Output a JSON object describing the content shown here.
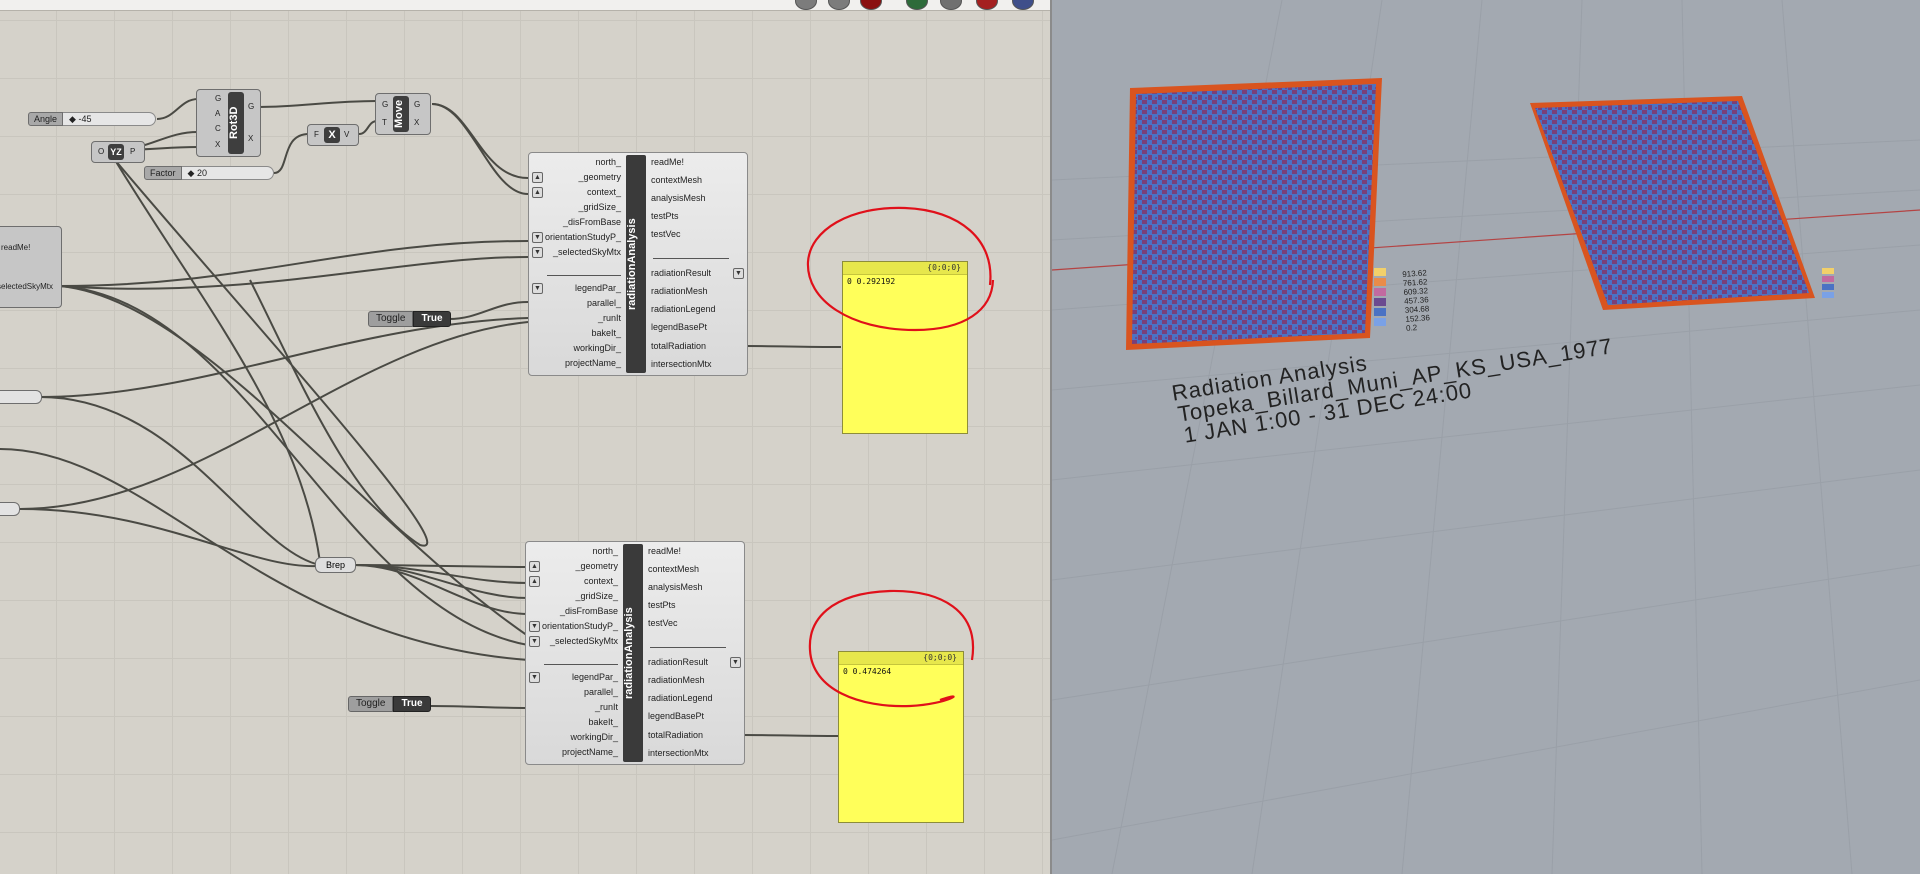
{
  "canvas": {
    "sliders": [
      {
        "label": "Angle",
        "value": "-45"
      },
      {
        "label": "Factor",
        "value": "20"
      }
    ],
    "components": {
      "rot3d": {
        "name": "Rot3D",
        "inputs": [
          "G",
          "A",
          "C",
          "X"
        ],
        "outputs": [
          "G",
          "X"
        ]
      },
      "move": {
        "name": "Move",
        "inputs": [
          "G",
          "T"
        ],
        "outputs": [
          "G",
          "X"
        ]
      },
      "yz": {
        "name": "YZ",
        "inputs": [
          "O"
        ],
        "outputs": [
          "P"
        ]
      },
      "multiply": {
        "name": "X",
        "inputs": [
          "F"
        ],
        "outputs": [
          "V"
        ]
      },
      "partial_left": {
        "outputs": [
          "readMe!",
          "selectedSkyMtx"
        ]
      },
      "brep": {
        "label": "Brep"
      }
    },
    "toggles": [
      {
        "label": "Toggle",
        "value": "True"
      },
      {
        "label": "Toggle",
        "value": "True"
      }
    ],
    "radiation_analysis": {
      "title": "radiationAnalysis",
      "inputs": [
        "north_",
        "_geometry",
        "context_",
        "_gridSize_",
        "_disFromBase",
        "orientationStudyP_",
        "_selectedSkyMtx",
        "legendPar_",
        "parallel_",
        "_runIt",
        "bakeIt_",
        "workingDir_",
        "projectName_"
      ],
      "outputs": [
        "readMe!",
        "contextMesh",
        "analysisMesh",
        "testPts",
        "testVec",
        "radiationResult",
        "radiationMesh",
        "radiationLegend",
        "legendBasePt",
        "totalRadiation",
        "intersectionMtx"
      ]
    },
    "panels": [
      {
        "path": "{0;0;0}",
        "index": "0",
        "value": "0.292192"
      },
      {
        "path": "{0;0;0}",
        "index": "0",
        "value": "0.474264"
      }
    ]
  },
  "viewport": {
    "title_lines": [
      "Radiation Analysis",
      "Topeka_Billard_Muni_AP_KS_USA_1977",
      "1 JAN 1:00 - 31 DEC 24:00"
    ],
    "legend_values": [
      "0.2",
      "152.36",
      "304.68",
      "457.36",
      "609.32",
      "761.62",
      "913.62"
    ],
    "colors": {
      "annotation_red": "#e0101a",
      "panel_yellow": "#ffff5a",
      "mesh_blue": "#4a72c4",
      "mesh_purple": "#7a3f78",
      "frame_orange": "#d9541f",
      "axis_red": "#b44343"
    }
  }
}
